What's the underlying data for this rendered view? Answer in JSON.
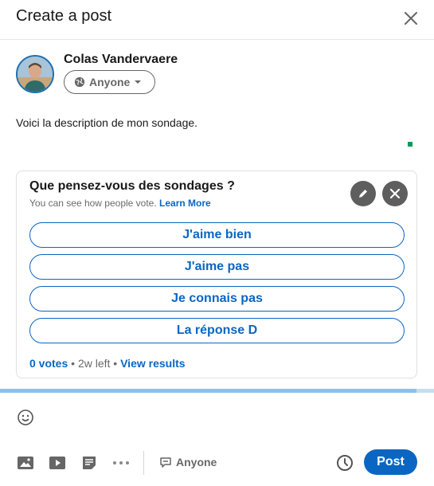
{
  "header": {
    "title": "Create a post"
  },
  "author": {
    "name": "Colas Vandervaere",
    "visibility": "Anyone"
  },
  "post": {
    "text": "Voici la description de mon sondage."
  },
  "poll": {
    "question": "Que pensez-vous des sondages ?",
    "subtitle": "You can see how people vote.",
    "learn_more": "Learn More",
    "options": [
      "J'aime bien",
      "J'aime pas",
      "Je connais pas",
      "La réponse D"
    ],
    "votes": "0 votes",
    "time_left": "2w left",
    "view_results": "View results"
  },
  "progress": {
    "fraction": 0.96
  },
  "toolbar": {
    "comment_control": "Anyone",
    "post_label": "Post"
  },
  "icons": {
    "close": "close-icon",
    "globe": "globe-icon",
    "caret": "caret-down-icon",
    "edit": "pencil-icon",
    "remove": "x-icon",
    "emoji": "smiley-icon",
    "photo": "image-icon",
    "video": "video-icon",
    "document": "document-icon",
    "more": "more-icon",
    "comment": "speech-bubble-icon",
    "schedule": "clock-icon"
  },
  "colors": {
    "accent": "#0a66c2",
    "progress": "#8dc0e6",
    "circle_button": "#5e5e5e"
  }
}
